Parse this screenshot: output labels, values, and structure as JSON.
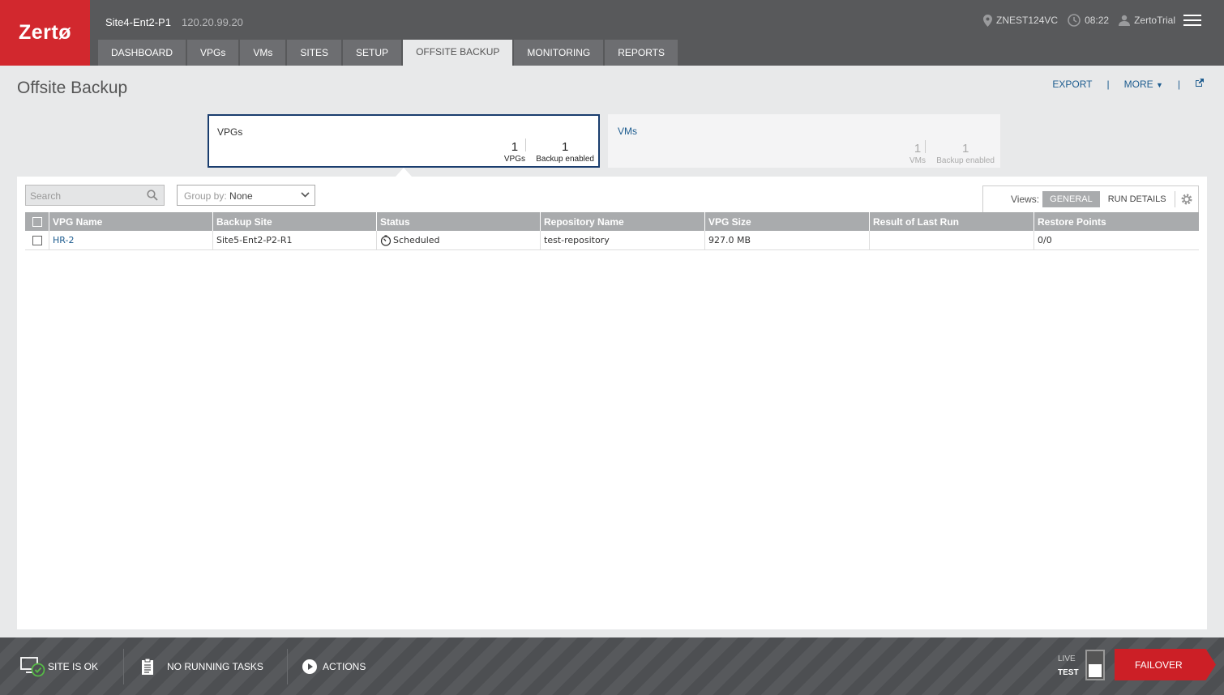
{
  "header": {
    "logo": "Zertø",
    "site_name": "Site4-Ent2-P1",
    "site_ip": "120.20.99.20",
    "vcenter": "ZNEST124VC",
    "time": "08:22",
    "user": "ZertoTrial"
  },
  "tabs": [
    {
      "label": "DASHBOARD"
    },
    {
      "label": "VPGs"
    },
    {
      "label": "VMs"
    },
    {
      "label": "SITES"
    },
    {
      "label": "SETUP"
    },
    {
      "label": "OFFSITE BACKUP"
    },
    {
      "label": "MONITORING"
    },
    {
      "label": "REPORTS"
    }
  ],
  "page": {
    "title": "Offsite Backup",
    "export_label": "EXPORT",
    "more_label": "MORE"
  },
  "cards": {
    "vpgs": {
      "title": "VPGs",
      "count": "1",
      "count_label": "VPGs",
      "backup": "1",
      "backup_label": "Backup enabled"
    },
    "vms": {
      "title": "VMs",
      "count": "1",
      "count_label": "VMs",
      "backup": "1",
      "backup_label": "Backup enabled"
    }
  },
  "toolbar": {
    "search_placeholder": "Search",
    "groupby_label": "Group by:",
    "groupby_value": "None",
    "views_label": "Views:",
    "view_general": "GENERAL",
    "view_run_details": "RUN DETAILS"
  },
  "table": {
    "columns": [
      "VPG Name",
      "Backup Site",
      "Status",
      "Repository Name",
      "VPG Size",
      "Result of Last Run",
      "Restore Points"
    ],
    "rows": [
      {
        "vpg_name": "HR-2",
        "backup_site": "Site5-Ent2-P2-R1",
        "status": "Scheduled",
        "repository": "test-repository",
        "size": "927.0 MB",
        "last_run": "",
        "restore_points": "0/0"
      }
    ]
  },
  "footer": {
    "site_status": "SITE IS OK",
    "tasks": "NO RUNNING TASKS",
    "actions": "ACTIONS",
    "live": "LIVE",
    "test": "TEST",
    "failover": "FAILOVER"
  }
}
